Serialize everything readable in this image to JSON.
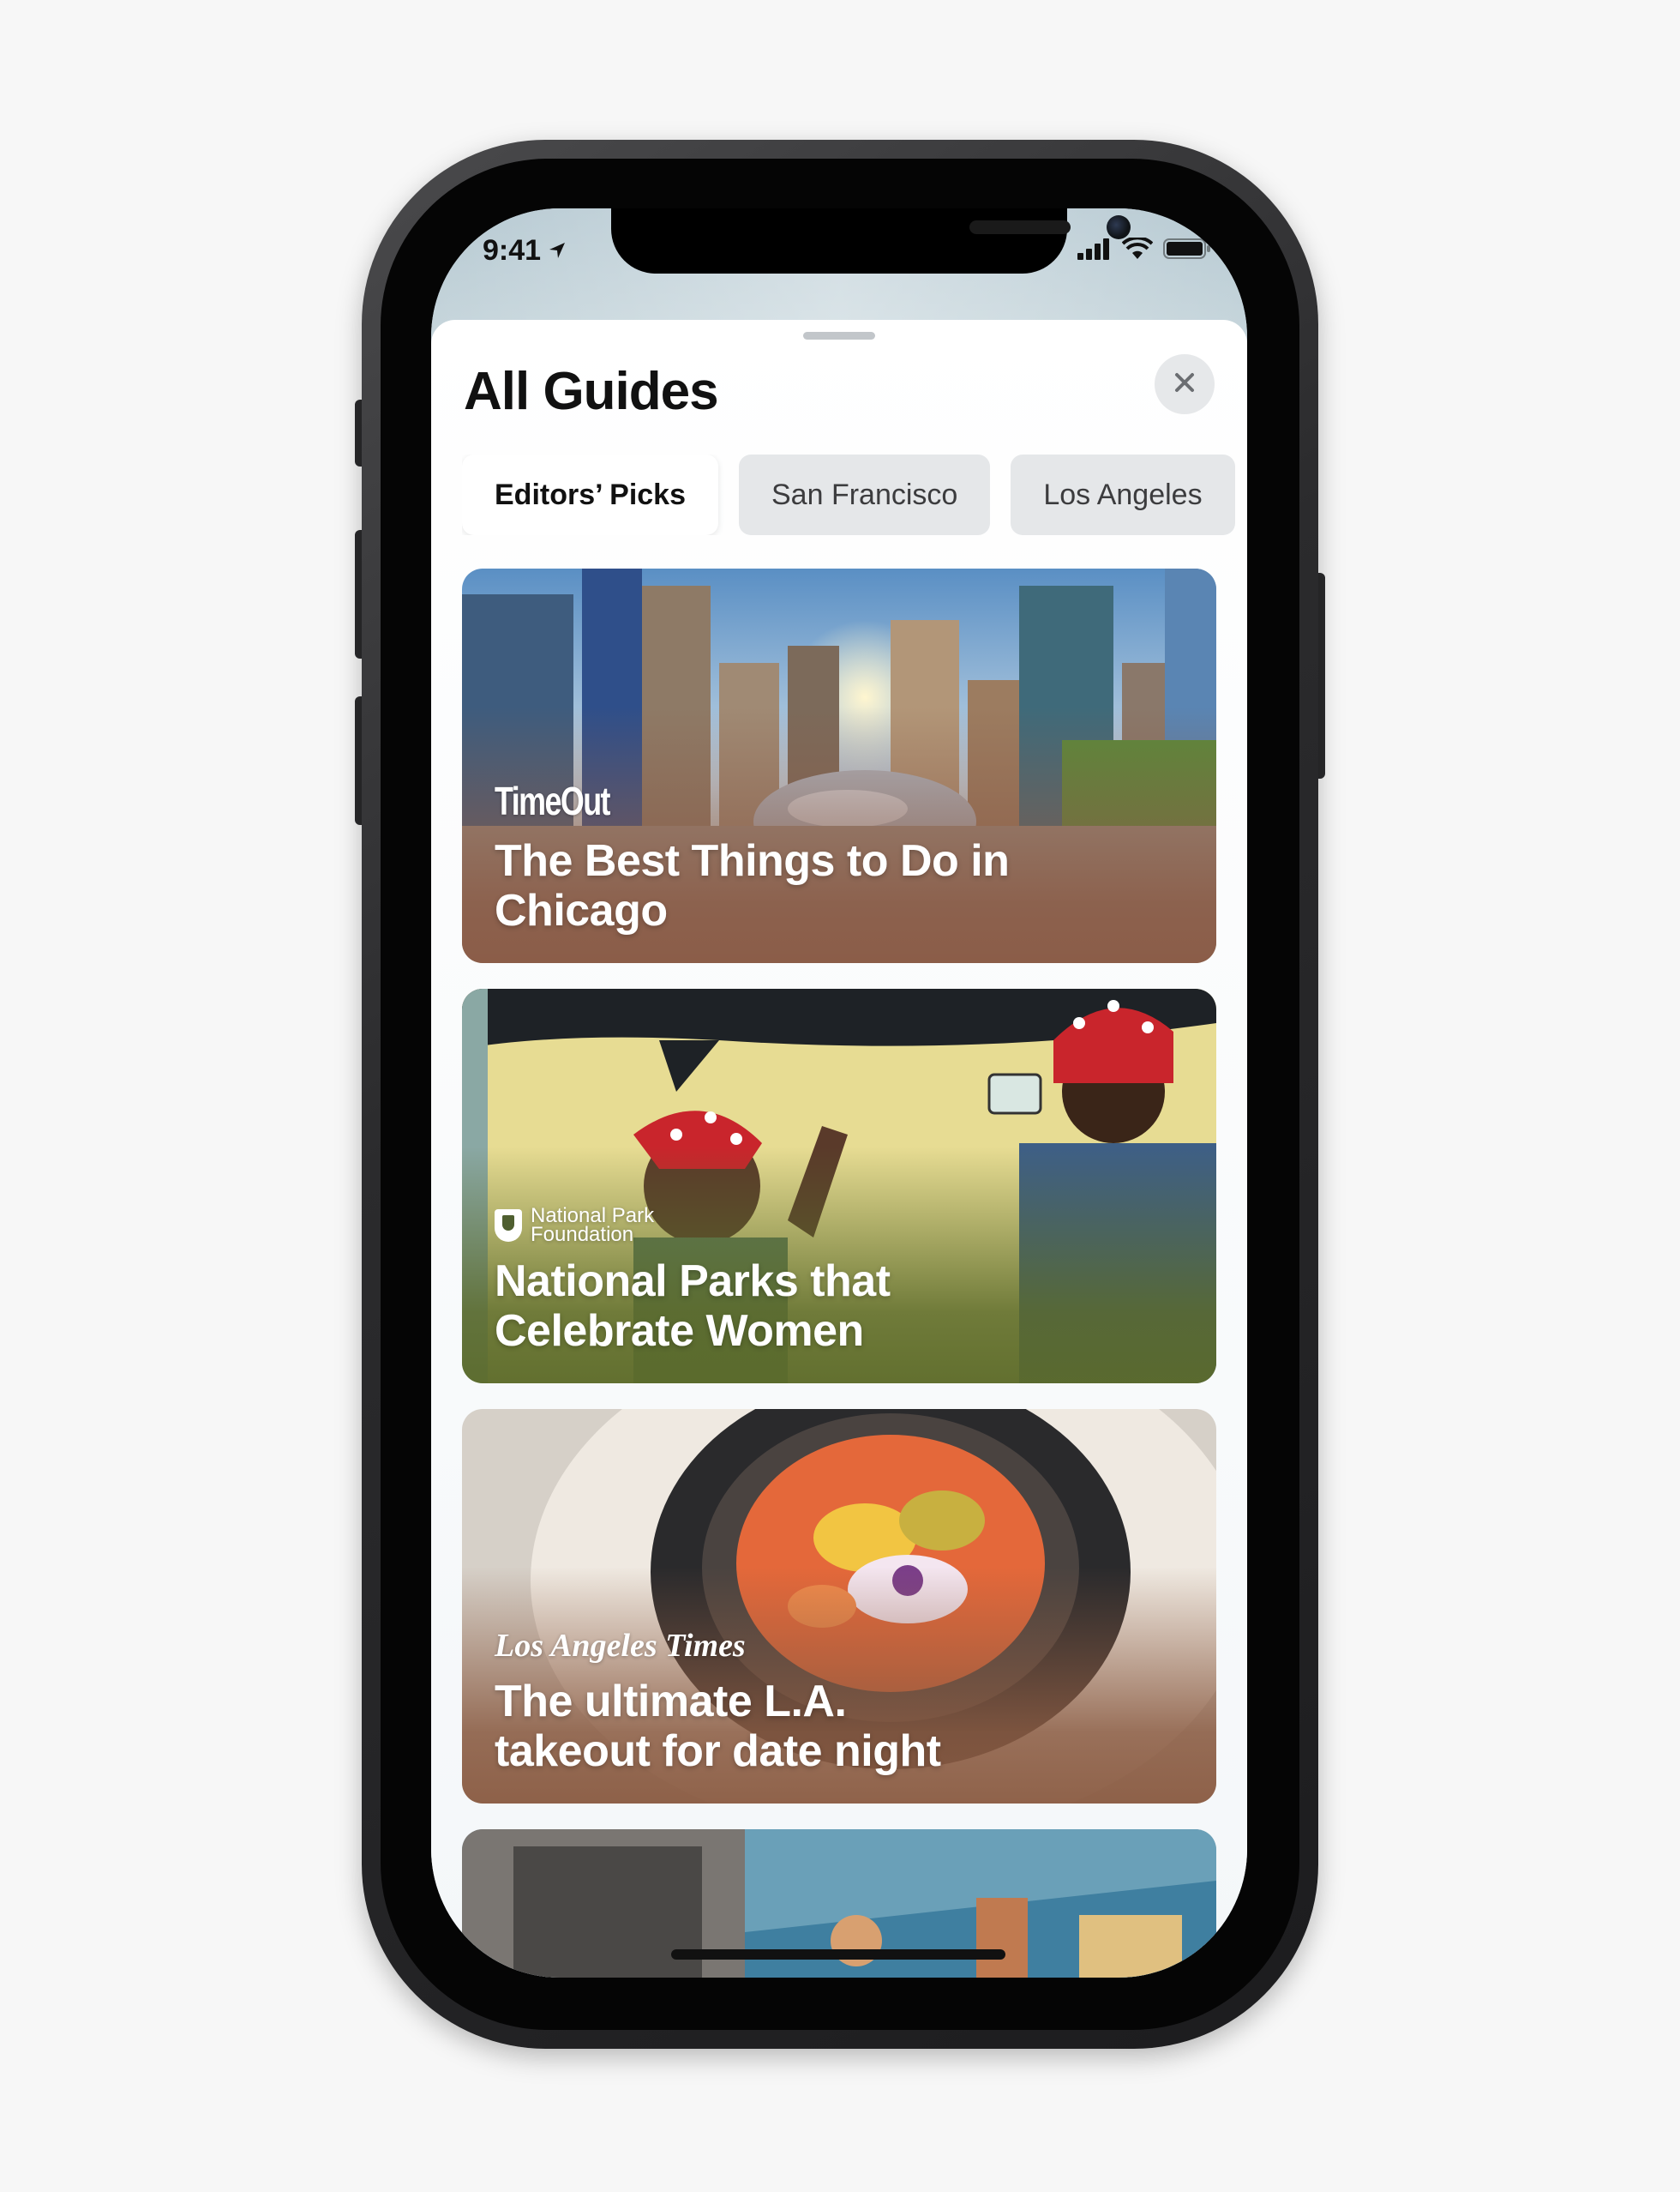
{
  "status_bar": {
    "time": "9:41"
  },
  "sheet": {
    "title": "All Guides",
    "close_icon": "close-icon"
  },
  "tabs": [
    {
      "label": "Editors’ Picks",
      "active": true
    },
    {
      "label": "San Francisco",
      "active": false
    },
    {
      "label": "Los Angeles",
      "active": false
    }
  ],
  "cards": [
    {
      "publisher": "TimeOut",
      "title": "The Best Things to Do in Chicago",
      "image": "chicago-skyline-bean",
      "tint": "#8a5a45"
    },
    {
      "publisher": "National Park Foundation",
      "title": "National Parks that Celebrate Women",
      "image": "we-can-do-it-mural",
      "tint": "#5b6a2a"
    },
    {
      "publisher": "Los Angeles Times",
      "title": "The ultimate L.A. takeout for date night",
      "image": "takeout-dish",
      "tint": "#8a5b42"
    },
    {
      "publisher": "",
      "title": "",
      "image": "street-mural",
      "tint": "#5a7a8a"
    }
  ],
  "colors": {
    "phone_frame": "#2b2b2d",
    "tab_active_bg": "#ffffff",
    "tab_inactive_bg": "#e5e7e9"
  }
}
